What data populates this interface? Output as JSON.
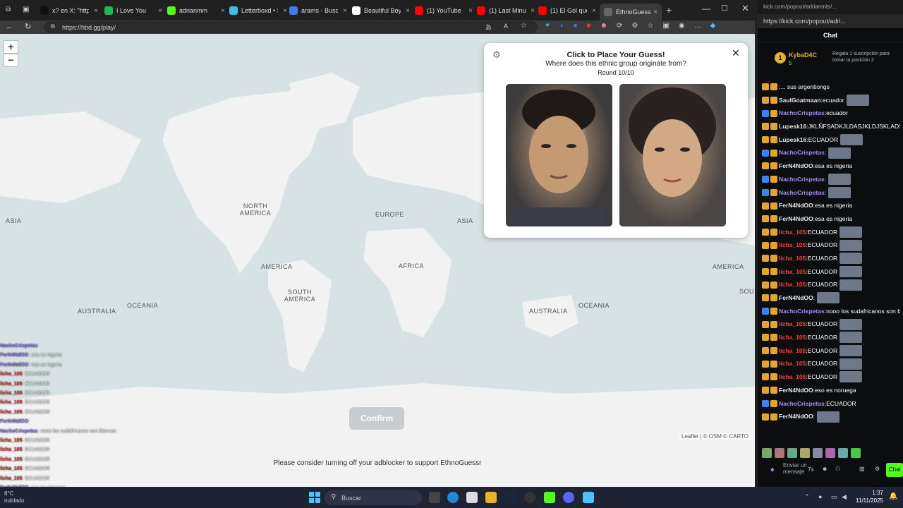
{
  "browser": {
    "tabs": [
      {
        "label": "x? en X: \"https:",
        "icon": "x-icon",
        "color": "#111111"
      },
      {
        "label": "I Love You",
        "icon": "spotify-icon",
        "color": "#1db954"
      },
      {
        "label": "adrianmm",
        "icon": "kick-icon",
        "color": "#53fc18"
      },
      {
        "label": "Letterboxd • Se",
        "icon": "letterboxd-icon",
        "color": "#40bcf4"
      },
      {
        "label": "arams - Buscar",
        "icon": "search-icon",
        "color": "#3c7df0"
      },
      {
        "label": "Beautiful Boy -",
        "icon": "google-icon",
        "color": "#ffffff"
      },
      {
        "label": "(1) YouTube",
        "icon": "youtube-icon",
        "color": "#ff0000"
      },
      {
        "label": "(1) Last Minute",
        "icon": "youtube-icon",
        "color": "#ff0000"
      },
      {
        "label": "(1) El Gol que m",
        "icon": "youtube-icon",
        "color": "#ff0000"
      },
      {
        "label": "EthnoGuessr",
        "icon": "ethnoguessr-icon",
        "color": "#666666"
      }
    ],
    "url": "https://hbd.gg/play/"
  },
  "map": {
    "labels": {
      "asia_left": "ASIA",
      "north_america": "NORTH\nAMERICA",
      "europe": "EUROPE",
      "asia": "ASIA",
      "america": "AMERICA",
      "africa": "AFRICA",
      "south_america": "SOUTH\nAMERICA",
      "america_right": "AMERICA",
      "australia_left": "AUSTRALIA",
      "oceania_left": "OCEANIA",
      "australia": "AUSTRALIA",
      "oceania": "OCEANIA",
      "south_right": "SOU"
    },
    "zoom_in": "+",
    "zoom_out": "−",
    "confirm_label": "Confirm",
    "attribution": "Leaflet | © OSM © CARTO"
  },
  "card": {
    "title": "Click to Place Your Guess!",
    "subtitle": "Where does this ethnic group originate from?",
    "round": "Round 10/10"
  },
  "adnote": "Please consider turning off your adblocker to support EthnoGuessr",
  "overlay_chat": [
    {
      "user": "NachoCrispetas",
      "text": ""
    },
    {
      "user": "FerN4NdOO",
      "text": "esa es nigeria"
    },
    {
      "user": "FerN4NdOO",
      "text": "esa es nigeria"
    },
    {
      "user": "licha_105",
      "text": "ECUADOR"
    },
    {
      "user": "licha_105",
      "text": "ECUADOR"
    },
    {
      "user": "licha_105",
      "text": "ECUADOR"
    },
    {
      "user": "licha_105",
      "text": "ECUADOR"
    },
    {
      "user": "licha_105",
      "text": "ECUADOR"
    },
    {
      "user": "FerN4NdOO",
      "text": ""
    },
    {
      "user": "NachoCrispetas",
      "text": "nooo los sudafricanos son blancos"
    },
    {
      "user": "licha_105",
      "text": "ECUADOR"
    },
    {
      "user": "licha_105",
      "text": "ECUADOR"
    },
    {
      "user": "licha_105",
      "text": "ECUADOR"
    },
    {
      "user": "licha_105",
      "text": "ECUADOR"
    },
    {
      "user": "licha_105",
      "text": "ECUADOR"
    },
    {
      "user": "FerN4NdOO",
      "text": "eso es noruega"
    },
    {
      "user": "NachoCrispetas",
      "text": "ECUADOR"
    }
  ],
  "taskbar": {
    "search": "Buscar",
    "time": "1:37",
    "date": "11/11/2025",
    "weather": "8°C\nnublado"
  },
  "kick": {
    "title": "kick.com/popout/adrianmts/...",
    "url": "https://kick.com/popout/adri...",
    "chat_header": "Chat",
    "pinned_user": "KybaD4C",
    "pinned_count": "5",
    "pinned_text": "Regala 1 suscripción para tomar la posición 2",
    "messages": [
      {
        "user": "",
        "text": "... sus argentiongs",
        "cls": "u3"
      },
      {
        "user": "SaulGoatmaan",
        "text": "ecuador",
        "cls": "u3",
        "emote": true
      },
      {
        "user": "NachoCrispetas",
        "text": "ecuador",
        "cls": "u1"
      },
      {
        "user": "Lupesk16",
        "text": "JKLÑFSADKJLDASJKLDJSKLADSA",
        "cls": "u3"
      },
      {
        "user": "Lupesk16",
        "text": "ECUADOR",
        "cls": "u3",
        "emote": true
      },
      {
        "user": "NachoCrispetas",
        "text": "",
        "cls": "u1",
        "emote": true
      },
      {
        "user": "FerN4NdOO",
        "text": "esa es nigeria",
        "cls": "u3"
      },
      {
        "user": "NachoCrispetas",
        "text": "",
        "cls": "u1",
        "emote": true
      },
      {
        "user": "NachoCrispetas",
        "text": "",
        "cls": "u1",
        "emote": true
      },
      {
        "user": "FerN4NdOO",
        "text": "esa es nigeria",
        "cls": "u3"
      },
      {
        "user": "FerN4NdOO",
        "text": "esa es nigeria",
        "cls": "u3"
      },
      {
        "user": "licha_105",
        "text": "ECUADOR",
        "cls": "u2",
        "emote": true
      },
      {
        "user": "licha_105",
        "text": "ECUADOR",
        "cls": "u2",
        "emote": true
      },
      {
        "user": "licha_105",
        "text": "ECUADOR",
        "cls": "u2",
        "emote": true
      },
      {
        "user": "licha_105",
        "text": "ECUADOR",
        "cls": "u2",
        "emote": true
      },
      {
        "user": "licha_105",
        "text": "ECUADOR",
        "cls": "u2",
        "emote": true
      },
      {
        "user": "FerN4NdOO",
        "text": "",
        "cls": "u3",
        "emote": true
      },
      {
        "user": "NachoCrispetas",
        "text": "nooo los sudafricanos son blancos",
        "cls": "u1"
      },
      {
        "user": "licha_105",
        "text": "ECUADOR",
        "cls": "u2",
        "emote": true
      },
      {
        "user": "licha_105",
        "text": "ECUADOR",
        "cls": "u2",
        "emote": true
      },
      {
        "user": "licha_105",
        "text": "ECUADOR",
        "cls": "u2",
        "emote": true
      },
      {
        "user": "licha_105",
        "text": "ECUADOR",
        "cls": "u2",
        "emote": true
      },
      {
        "user": "licha_105",
        "text": "ECUADOR",
        "cls": "u2",
        "emote": true
      },
      {
        "user": "FerN4NdOO",
        "text": "eso es noruega",
        "cls": "u3"
      },
      {
        "user": "NachoCrispetas",
        "text": "ECUADOR",
        "cls": "u1"
      },
      {
        "user": "FerN4NdOO",
        "text": "",
        "cls": "u3",
        "emote": true
      }
    ],
    "input_placeholder": "Enviar un mensaje",
    "chat_button": "Chat"
  },
  "colors": {
    "kick_green": "#53fc18",
    "map_water": "#d6e2e3",
    "map_land": "#f2f2f2"
  }
}
